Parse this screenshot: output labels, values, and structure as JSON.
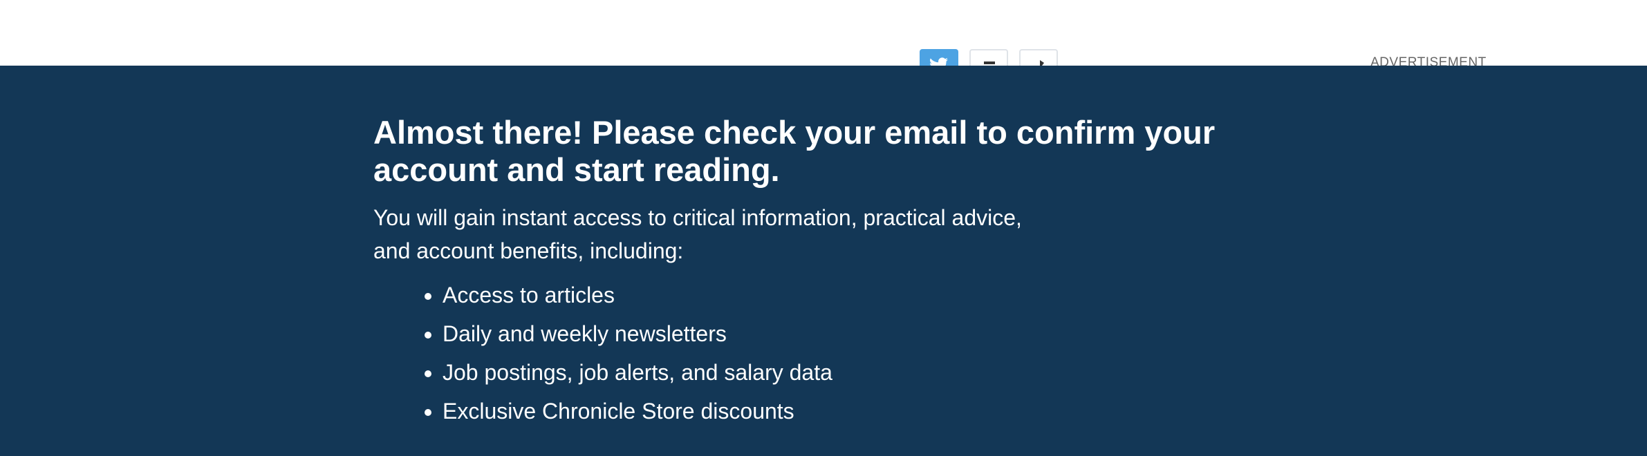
{
  "top_bar": {
    "share_buttons": [
      {
        "icon": "twitter-icon",
        "color": "#4da3e3"
      },
      {
        "icon": "email-icon"
      },
      {
        "icon": "print-icon"
      }
    ],
    "ad_label": "ADVERTISEMENT"
  },
  "overlay": {
    "background": "#133756",
    "headline": "Almost there! Please check your email to confirm your account and start reading.",
    "intro": "You will gain instant access to critical information, practical advice, and account benefits, including:",
    "benefits": [
      "Access to articles",
      "Daily and weekly newsletters",
      "Job postings, job alerts, and salary data",
      "Exclusive Chronicle Store discounts"
    ]
  }
}
